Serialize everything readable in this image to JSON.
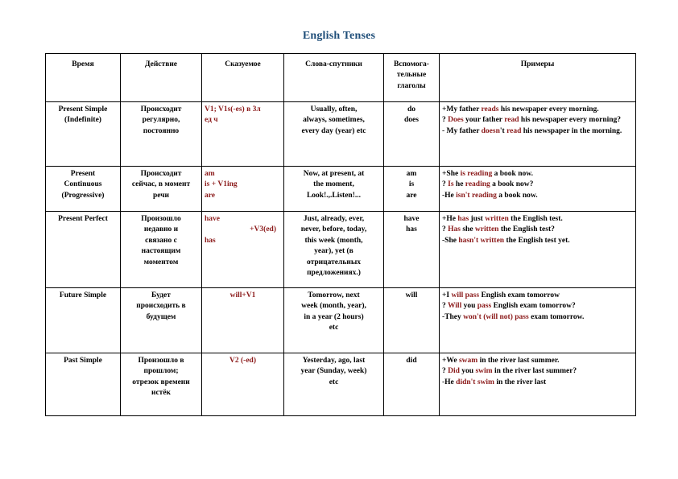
{
  "document": {
    "title": "English Tenses",
    "title_color": "#1f4e79",
    "accent_color": "#8b1a1a"
  },
  "table": {
    "headers": [
      "Время",
      "Действие",
      "Сказуемое",
      "Слова-спутники",
      "Вспомога-\nтельные\nглаголы",
      "Примеры"
    ],
    "header_aux_line1": "Вспомога-",
    "header_aux_line2": "тельные",
    "header_aux_line3": "глаголы",
    "rows": [
      {
        "time": "Present Simple\n(Indefinite)",
        "time_line1": "Present Simple",
        "time_line2": "(Indefinite)",
        "action_line1": "Происходит",
        "action_line2": "регулярно,",
        "action_line3": "постоянно",
        "predicate_line1": "V1; V1s(-es) в 3л",
        "predicate_line2": "ед ч",
        "signals_line1": "Usually, often,",
        "signals_line2": "always, sometimes,",
        "signals_line3": "every day (year) etc",
        "aux_line1": "do",
        "aux_line2": "does",
        "examples": [
          {
            "pre": "+My father ",
            "hl": "reads",
            "post": " his newspaper every morning."
          },
          {
            "pre": "? ",
            "hl": "Does",
            "mid": " your father ",
            "hl2": "read",
            "post": " his newspaper every morning?"
          },
          {
            "pre": "- My father ",
            "hl": "doesn",
            "mid": "'t ",
            "hl2": "read",
            "post": " his newspaper in the morning."
          }
        ]
      },
      {
        "time_line1": "Present",
        "time_line2": "Continuous",
        "time_line3": "(Progressive)",
        "action_line1": "Происходит",
        "action_line2": "сейчас, в момент",
        "action_line3": "речи",
        "predicate_line1": "am",
        "predicate_line2": "is  + V1ing",
        "predicate_line3": "are",
        "signals_line1": "Now, at present, at",
        "signals_line2": "the moment,",
        "signals_line3": "Look!.,.Listen!...",
        "aux_line1": "am",
        "aux_line2": "is",
        "aux_line3": "are",
        "examples": [
          {
            "pre": "+She ",
            "hl": "is reading",
            "post": " a book now."
          },
          {
            "pre": "? ",
            "hl": "Is",
            "mid": " he ",
            "hl2": "reading",
            "post": " a book now?"
          },
          {
            "pre": "-He ",
            "hl": "isn't reading",
            "post": " a book now."
          }
        ]
      },
      {
        "time_line1": "Present Perfect",
        "action_line1": "Произошло",
        "action_line2": "недавно и",
        "action_line3": "связано с",
        "action_line4": "настоящим",
        "action_line5": "моментом",
        "predicate_line1": "have",
        "predicate_line2": "+V3(ed)",
        "predicate_line3": "has",
        "signals_line1": "Just, already, ever,",
        "signals_line2": "never, before, today,",
        "signals_line3": "this week (month,",
        "signals_line4": "year), yet (в",
        "signals_line5": "отрицательных",
        "signals_line6": "предложениях.)",
        "aux_line1": "have",
        "aux_line2": "has",
        "examples": [
          {
            "pre": "+He ",
            "hl": "has",
            "mid": " just ",
            "hl2": "written",
            "post": " the English test."
          },
          {
            "pre": "? ",
            "hl": "Has",
            "mid": " she ",
            "hl2": "written",
            "post": " the English test?"
          },
          {
            "pre": "-She ",
            "hl": "hasn't written",
            "post": " the English test yet."
          }
        ]
      },
      {
        "time_line1": "Future Simple",
        "action_line1": "Будет",
        "action_line2": "происходить в",
        "action_line3": "будущем",
        "predicate_line1": "will+V1",
        "signals_line1": "Tomorrow, next",
        "signals_line2": "week (month, year),",
        "signals_line3": "in a year (2 hours)",
        "signals_line4": "etc",
        "aux_line1": "will",
        "examples": [
          {
            "pre": "+I ",
            "hl": "will pass",
            "post": " English exam tomorrow"
          },
          {
            "pre": "? ",
            "hl": "Will",
            "mid": " you ",
            "hl2": "pass",
            "post": " English exam tomorrow?"
          },
          {
            "pre": "-They ",
            "hl": "won't (will not) pass",
            "post": " exam tomorrow."
          }
        ]
      },
      {
        "time_line1": "Past Simple",
        "action_line1": "Произошло в",
        "action_line2": "прошлом;",
        "action_line3": "отрезок времени",
        "action_line4": "истёк",
        "predicate_line1": "V2 (-ed)",
        "signals_line1": "Yesterday, ago, last",
        "signals_line2": "year (Sunday, week)",
        "signals_line3": "etc",
        "aux_line1": "did",
        "examples": [
          {
            "pre": "+We ",
            "hl": "swam",
            "post": " in the river last summer."
          },
          {
            "pre": "? ",
            "hl": "Did",
            "mid": " you ",
            "hl2": "swim",
            "post": " in the river last summer?"
          },
          {
            "pre": "-He ",
            "hl": "didn't swim",
            "post": " in the river last"
          }
        ]
      }
    ]
  }
}
